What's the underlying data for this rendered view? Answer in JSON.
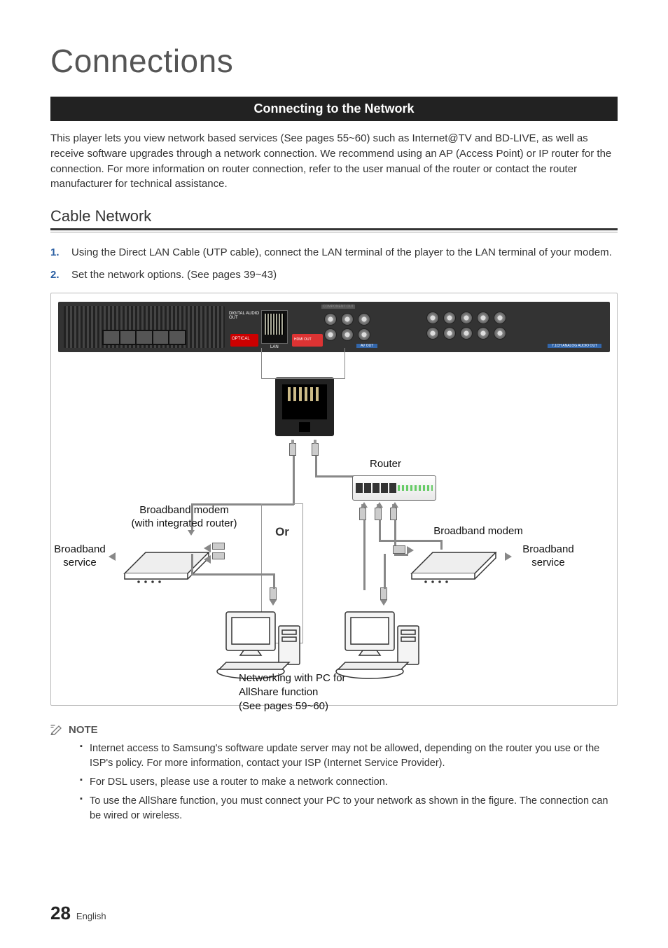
{
  "title": "Connections",
  "section_bar": "Connecting to the Network",
  "intro": "This player lets you view network based services (See pages 55~60) such as Internet@TV and BD-LIVE, as well as receive software upgrades through a network connection. We recommend using an AP (Access Point) or IP router for the connection. For more information on router connection, refer to the user manual of the router or contact the router manufacturer for technical assistance.",
  "sub_heading": "Cable Network",
  "steps": [
    {
      "num": "1.",
      "text": "Using the Direct LAN Cable (UTP cable), connect the LAN terminal of the player to the LAN terminal of your modem."
    },
    {
      "num": "2.",
      "text": "Set the network options. (See pages 39~43)"
    }
  ],
  "diagram": {
    "panel": {
      "optical": "OPTICAL",
      "digital_audio_out": "DIGITAL AUDIO OUT",
      "lan": "LAN",
      "hdmi": "HDMI OUT",
      "component_out": "COMPONENT OUT",
      "av_out": "AV OUT",
      "analog_out": "7.1CH ANALOG AUDIO OUT"
    },
    "or_label": "Or",
    "router_label": "Router",
    "left_modem_label": "Broadband modem\n(with integrated router)",
    "right_modem_label": "Broadband modem",
    "broadband_service_left": "Broadband\nservice",
    "broadband_service_right": "Broadband\nservice",
    "caption": "Networking with PC for\nAllShare function\n(See pages 59~60)"
  },
  "note_heading": "NOTE",
  "notes": [
    "Internet access to Samsung's software update server may not be allowed, depending on the router you use or the ISP's policy. For more information, contact your ISP (Internet Service Provider).",
    "For DSL users, please use a router to make a network connection.",
    "To use the AllShare function, you must connect your PC to your network as shown in the figure. The connection can be wired or wireless."
  ],
  "footer": {
    "page": "28",
    "lang": "English"
  }
}
